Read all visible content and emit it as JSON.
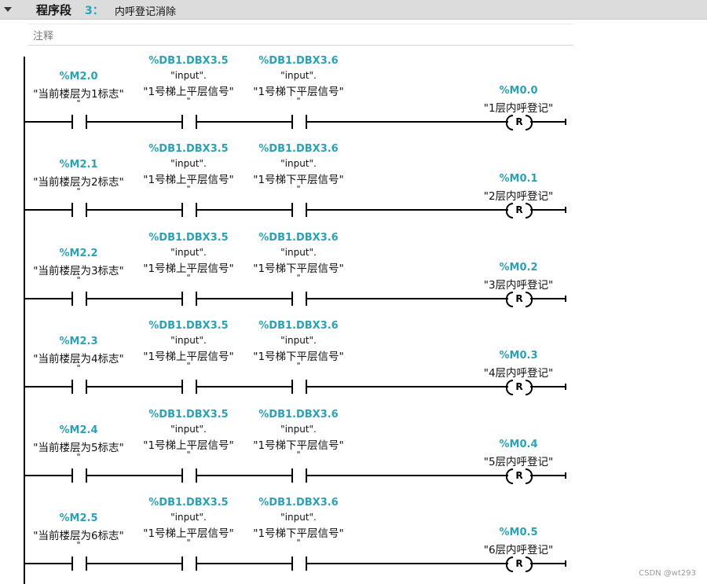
{
  "network": {
    "label": "程序段",
    "number": "3：",
    "title": "内呼登记消除",
    "comment_placeholder": "注释"
  },
  "colors": {
    "address": "#2aa2b4",
    "header_bg": "#dcdcdc",
    "wire": "#000000"
  },
  "icons": {
    "collapse": "triangle-down-icon"
  },
  "rungs": [
    {
      "contact1": {
        "address": "%M2.0",
        "tag": "\"当前楼层为1标志\"",
        "suffix": "\""
      },
      "contact2": {
        "address": "%DB1.DBX3.5",
        "db": "\"input\".",
        "tag": "\"1号梯上平层信号\"",
        "suffix": "\""
      },
      "contact3": {
        "address": "%DB1.DBX3.6",
        "db": "\"input\".",
        "tag": "\"1号梯下平层信号\"",
        "suffix": "\""
      },
      "coil": {
        "address": "%M0.0",
        "tag": "\"1层内呼登记\"",
        "type": "R"
      }
    },
    {
      "contact1": {
        "address": "%M2.1",
        "tag": "\"当前楼层为2标志\"",
        "suffix": "\""
      },
      "contact2": {
        "address": "%DB1.DBX3.5",
        "db": "\"input\".",
        "tag": "\"1号梯上平层信号\"",
        "suffix": "\""
      },
      "contact3": {
        "address": "%DB1.DBX3.6",
        "db": "\"input\".",
        "tag": "\"1号梯下平层信号\"",
        "suffix": "\""
      },
      "coil": {
        "address": "%M0.1",
        "tag": "\"2层内呼登记\"",
        "type": "R"
      }
    },
    {
      "contact1": {
        "address": "%M2.2",
        "tag": "\"当前楼层为3标志\"",
        "suffix": "\""
      },
      "contact2": {
        "address": "%DB1.DBX3.5",
        "db": "\"input\".",
        "tag": "\"1号梯上平层信号\"",
        "suffix": "\""
      },
      "contact3": {
        "address": "%DB1.DBX3.6",
        "db": "\"input\".",
        "tag": "\"1号梯下平层信号\"",
        "suffix": "\""
      },
      "coil": {
        "address": "%M0.2",
        "tag": "\"3层内呼登记\"",
        "type": "R"
      }
    },
    {
      "contact1": {
        "address": "%M2.3",
        "tag": "\"当前楼层为4标志\"",
        "suffix": "\""
      },
      "contact2": {
        "address": "%DB1.DBX3.5",
        "db": "\"input\".",
        "tag": "\"1号梯上平层信号\"",
        "suffix": "\""
      },
      "contact3": {
        "address": "%DB1.DBX3.6",
        "db": "\"input\".",
        "tag": "\"1号梯下平层信号\"",
        "suffix": "\""
      },
      "coil": {
        "address": "%M0.3",
        "tag": "\"4层内呼登记\"",
        "type": "R"
      }
    },
    {
      "contact1": {
        "address": "%M2.4",
        "tag": "\"当前楼层为5标志\"",
        "suffix": "\""
      },
      "contact2": {
        "address": "%DB1.DBX3.5",
        "db": "\"input\".",
        "tag": "\"1号梯上平层信号\"",
        "suffix": "\""
      },
      "contact3": {
        "address": "%DB1.DBX3.6",
        "db": "\"input\".",
        "tag": "\"1号梯下平层信号\"",
        "suffix": "\""
      },
      "coil": {
        "address": "%M0.4",
        "tag": "\"5层内呼登记\"",
        "type": "R"
      }
    },
    {
      "contact1": {
        "address": "%M2.5",
        "tag": "\"当前楼层为6标志\"",
        "suffix": "\""
      },
      "contact2": {
        "address": "%DB1.DBX3.5",
        "db": "\"input\".",
        "tag": "\"1号梯上平层信号\"",
        "suffix": "\""
      },
      "contact3": {
        "address": "%DB1.DBX3.6",
        "db": "\"input\".",
        "tag": "\"1号梯下平层信号\"",
        "suffix": "\""
      },
      "coil": {
        "address": "%M0.5",
        "tag": "\"6层内呼登记\"",
        "type": "R"
      }
    }
  ],
  "watermark": "CSDN @wt293"
}
